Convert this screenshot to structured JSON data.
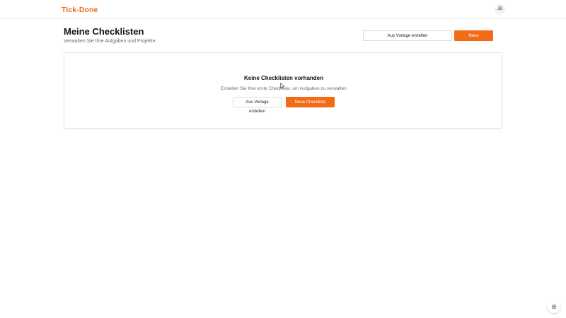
{
  "header": {
    "app_name": "Tick-Done",
    "avatar_initials": "JB"
  },
  "main": {
    "title": "Meine Checklisten",
    "subtitle": "Verwalten Sie Ihre Aufgaben und Projekte",
    "actions": {
      "template_label": "Aus Vorlage erstellen",
      "new_label": "Neue Checkliste"
    }
  },
  "empty_state": {
    "title": "Keine Checklisten vorhanden",
    "description": "Erstellen Sie Ihre erste Checkliste, um Aufgaben zu verwalten",
    "template_label": "Aus Vorlage erstellen",
    "new_label": "Neue Checkliste"
  },
  "floating": {
    "icon": "settings-icon"
  },
  "colors": {
    "brand": "#ea6a1a",
    "primary_button": "#f26b16"
  }
}
